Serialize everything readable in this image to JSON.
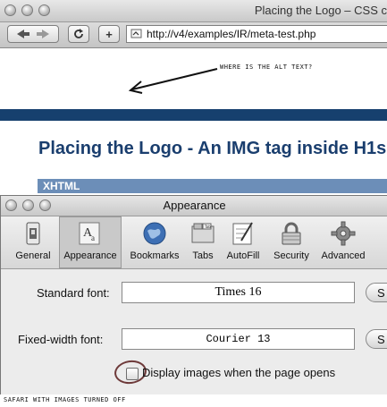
{
  "browser": {
    "window_title": "Placing the Logo – CSS c",
    "url": "http://v4/examples/IR/meta-test.php",
    "back_label": "◀ ▶",
    "reload_label": "C",
    "add_label": "+"
  },
  "page": {
    "annotation": "WHERE IS THE ALT TEXT?",
    "heading": "Placing the Logo - An IMG tag inside H1s",
    "section_bar": "XHTML"
  },
  "prefs": {
    "title": "Appearance",
    "toolbar": [
      {
        "label": "General",
        "icon": "general-switch-icon"
      },
      {
        "label": "Appearance",
        "icon": "appearance-font-icon"
      },
      {
        "label": "Bookmarks",
        "icon": "globe-icon"
      },
      {
        "label": "Tabs",
        "icon": "tabs-icon"
      },
      {
        "label": "AutoFill",
        "icon": "autofill-pen-icon"
      },
      {
        "label": "Security",
        "icon": "lock-icon"
      },
      {
        "label": "Advanced",
        "icon": "gear-icon"
      }
    ],
    "selected_tab": "Appearance",
    "standard_font_label": "Standard font:",
    "standard_font_value": "Times 16",
    "fixed_font_label": "Fixed-width font:",
    "fixed_font_value": "Courier 13",
    "select_button_label": "S",
    "checkbox_label": "Display images when the page opens",
    "checkbox_checked": false
  },
  "caption": "SAFARI WITH IMAGES TURNED OFF"
}
